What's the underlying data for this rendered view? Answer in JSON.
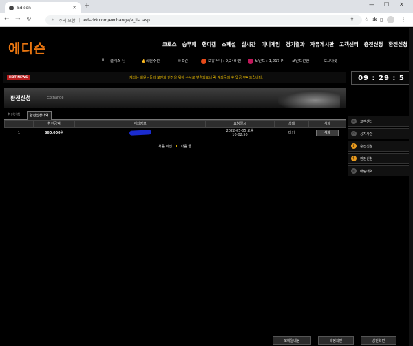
{
  "browser": {
    "tab_title": "Edison",
    "url_warning": "주의 요함",
    "url": "eds-99.com/exchange/e_list.asp"
  },
  "site": {
    "logo": "에디슨",
    "nav": [
      "크로스",
      "승무패",
      "핸디캡",
      "스페셜",
      "실시간",
      "미니게임",
      "경기결과",
      "자유게시판",
      "고객센터",
      "충전신청",
      "환전신청"
    ],
    "user": {
      "name": "클래스",
      "name_suffix": "님",
      "recommend": "회원추천",
      "messages": "0건",
      "money_label": "보유머니 : 9,240 원",
      "point_label": "포인트 : 1,217 P",
      "point_convert": "포인트전환",
      "logout": "로그아웃"
    },
    "news": {
      "badge": "HOT NEWS",
      "message": "계좌는 회원님들의 보안과 안전을 위해 수시로 변경되오니 꼭 계좌문의 후 입금 부탁드립니다."
    },
    "clock": "09 : 29 : 5"
  },
  "page": {
    "title": "환전신청",
    "subtitle": "Exchange",
    "tabs": [
      "환전신청",
      "환전신청내역"
    ],
    "table": {
      "headers": [
        "",
        "환전금액",
        "계좌정보",
        "요청일시",
        "상태",
        "삭제"
      ],
      "rows": [
        {
          "no": "1",
          "amount": "860,000원",
          "datetime_line1": "2022-05-05 오후",
          "datetime_line2": "10:02:50",
          "status": "대기",
          "delete": "삭제"
        }
      ]
    },
    "pager": {
      "first": "처음",
      "prev": "이전",
      "current": "1",
      "next": "다음",
      "last": "끝"
    }
  },
  "sidebar": [
    "고객센터",
    "공지사항",
    "충전신청",
    "환전신청",
    "배팅내역"
  ],
  "bottom_buttons": [
    "모바일배팅",
    "배팅화면",
    "상단화면"
  ]
}
